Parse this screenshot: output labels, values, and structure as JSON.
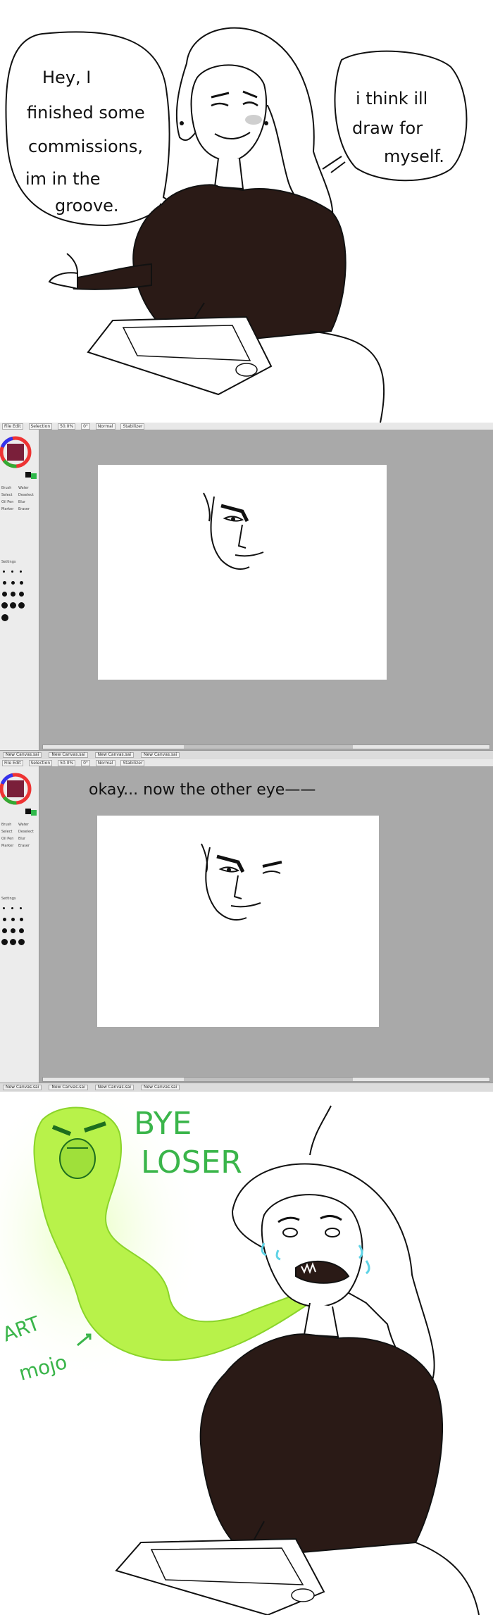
{
  "panel1": {
    "bubble_left": [
      "Hey, I",
      "finished some",
      "commissions,",
      "im in the",
      "groove."
    ],
    "bubble_right": [
      "i think ill",
      "draw for",
      "myself."
    ]
  },
  "panel2": {
    "toolbar_items": [
      "File  Edit",
      "Selection",
      "50.0%",
      "0°",
      "Normal",
      "Stabilizer"
    ],
    "side_labels": [
      "Brush",
      "Water",
      "Select",
      "Deselect",
      "Oil Pen",
      "Blur",
      "Marker",
      "Eraser",
      "Settings"
    ],
    "status_tabs": [
      "New Canvas.sai",
      "New Canvas.sai",
      "New Canvas.sai",
      "New Canvas.sai"
    ]
  },
  "panel3": {
    "caption": "okay... now the other eye——",
    "toolbar_items": [
      "File  Edit",
      "Selection",
      "50.0%",
      "0°",
      "Normal",
      "Stabilizer"
    ],
    "side_labels": [
      "Brush",
      "Water",
      "Select",
      "Deselect",
      "Oil Pen",
      "Blur",
      "Marker",
      "Eraser",
      "Settings"
    ],
    "status_tabs": [
      "New Canvas.sai",
      "New Canvas.sai",
      "New Canvas.sai",
      "New Canvas.sai"
    ]
  },
  "panel4": {
    "shout_line1": "BYE",
    "shout_line2": "LOSER",
    "label_line1": "ART",
    "label_line2": "mojo"
  },
  "colors": {
    "ink": "#111111",
    "sweater": "#2a1a16",
    "mojo_green": "#b8f24a",
    "mojo_glow": "#e8ffc0",
    "shout_green": "#3ab54a",
    "tears": "#5fd3e6",
    "app_gray": "#a9a9a9"
  }
}
